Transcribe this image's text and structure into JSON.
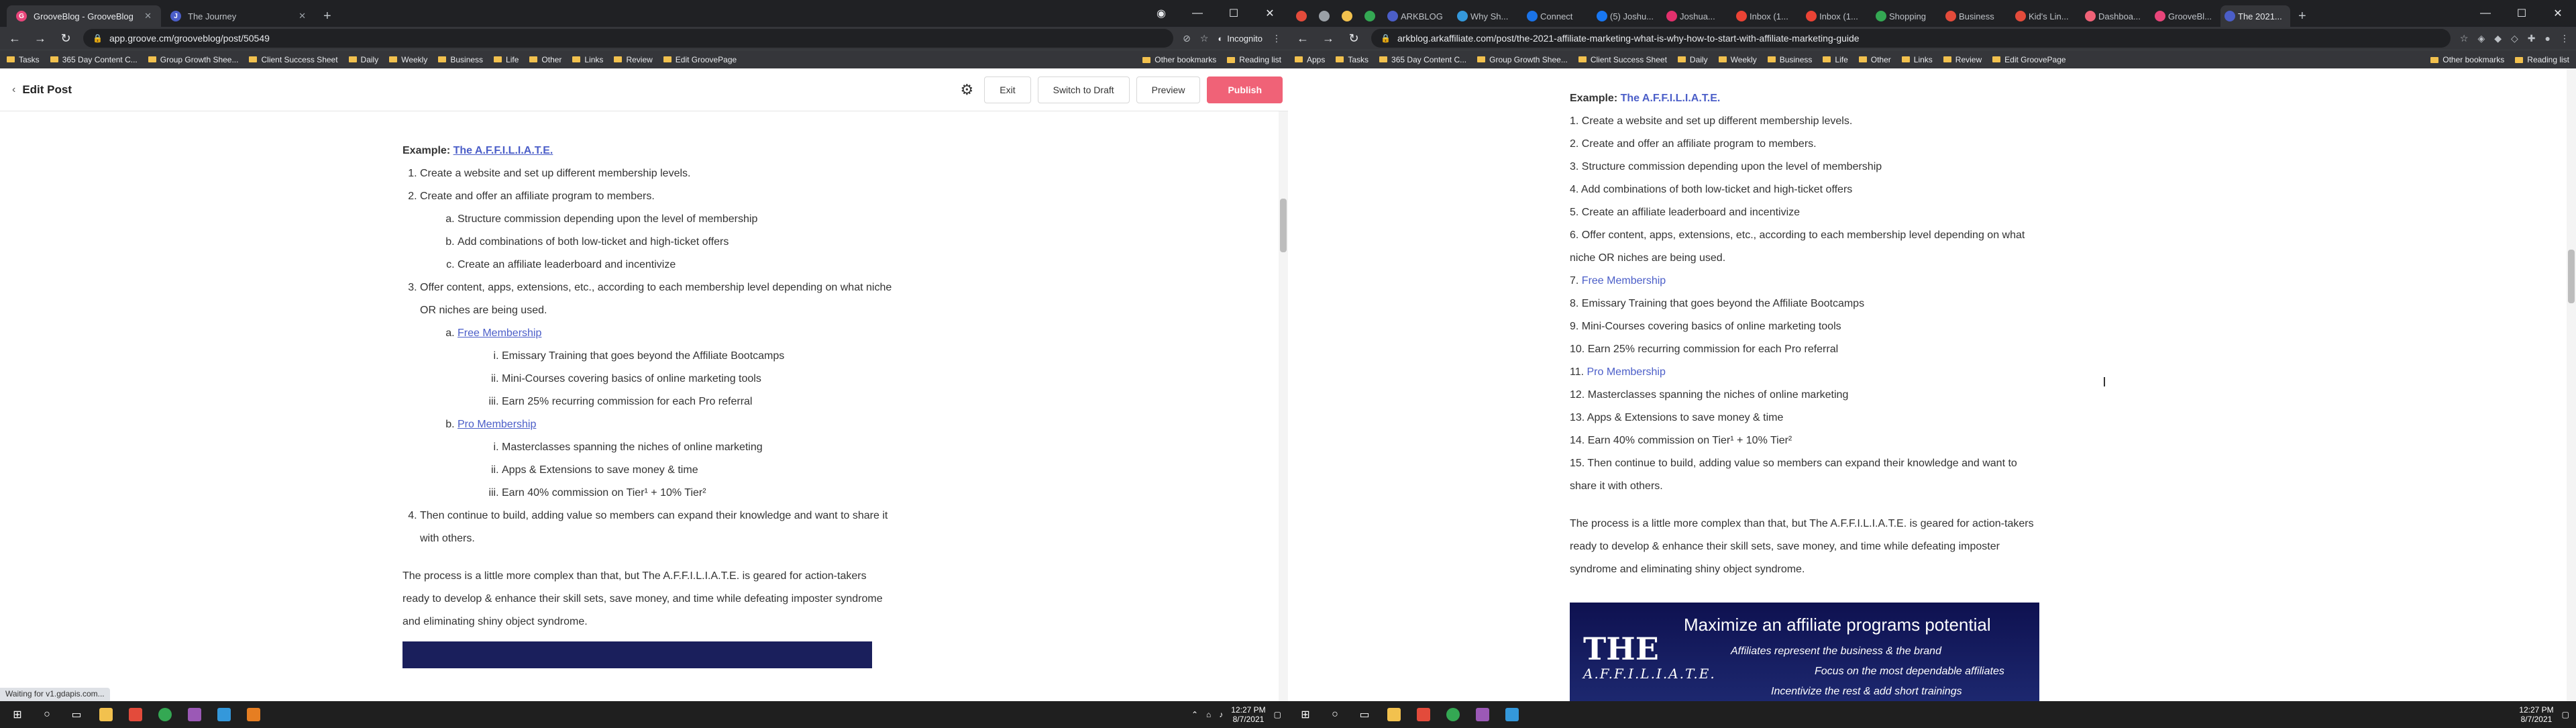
{
  "left": {
    "tabs": [
      {
        "title": "GrooveBlog - GrooveBlog",
        "color": "#e8457a",
        "active": true
      },
      {
        "title": "The Journey",
        "color": "#4b5ec8",
        "active": false
      }
    ],
    "url": "app.groove.cm/grooveblog/post/50549",
    "incognito_label": "Incognito",
    "bookmarks": [
      "Tasks",
      "365 Day Content C...",
      "Group Growth Shee...",
      "Client Success Sheet",
      "Daily",
      "Weekly",
      "Business",
      "Life",
      "Other",
      "Links",
      "Review",
      "Edit GroovePage"
    ],
    "bookmarks_right": [
      "Other bookmarks",
      "Reading list"
    ],
    "page_title": "Edit Post",
    "buttons": {
      "exit": "Exit",
      "draft": "Switch to Draft",
      "preview": "Preview",
      "publish": "Publish"
    },
    "status_text": "Waiting for v1.gdapis.com...",
    "clock_time": "12:27 PM",
    "clock_date": "8/7/2021"
  },
  "article": {
    "example_label": "Example:",
    "example_link": "The A.F.F.I.L.I.A.T.E.",
    "items": [
      {
        "text": "Create a website and set up different membership levels."
      },
      {
        "text": "Create and offer an affiliate program to members.",
        "sub": [
          "Structure commission depending upon the level of membership",
          "Add combinations of both low-ticket and high-ticket offers",
          "Create an affiliate leaderboard and incentivize"
        ]
      },
      {
        "text": "Offer content, apps, extensions, etc., according to each membership level depending on what niche OR niches are being used.",
        "sub_links": [
          {
            "label": "Free Membership",
            "sub": [
              "Emissary Training that goes beyond the Affiliate Bootcamps",
              "Mini-Courses covering basics of online marketing tools",
              "Earn 25% recurring commission for each Pro referral"
            ]
          },
          {
            "label": "Pro Membership",
            "sub": [
              "Masterclasses spanning the niches of online marketing",
              "Apps & Extensions to save money & time",
              "Earn 40% commission on Tier¹ + 10% Tier²"
            ]
          }
        ]
      },
      {
        "text": "Then continue to build, adding value so members can expand their knowledge and want to share it with others."
      }
    ],
    "paragraph": "The process is a little more complex than that, but The A.F.F.I.L.I.A.T.E. is geared for action-takers ready to develop & enhance their skill sets, save money, and time while defeating imposter syndrome and eliminating shiny object syndrome."
  },
  "right": {
    "tabs": [
      "",
      "",
      "",
      "",
      "ARKBLOG",
      "Why Sh...",
      "Connect",
      "(5) Joshu...",
      "Joshua...",
      "Inbox (1...",
      "Inbox (1...",
      "Shopping",
      "Business",
      "Kid's Lin...",
      "Dashboa...",
      "GrooveBl...",
      "The 2021..."
    ],
    "url": "arkblog.arkaffiliate.com/post/the-2021-affiliate-marketing-what-is-why-how-to-start-with-affiliate-marketing-guide",
    "bookmarks": [
      "Apps",
      "Tasks",
      "365 Day Content C...",
      "Group Growth Shee...",
      "Client Success Sheet",
      "Daily",
      "Weekly",
      "Business",
      "Life",
      "Other",
      "Links",
      "Review",
      "Edit GroovePage"
    ],
    "bookmarks_right": [
      "Other bookmarks",
      "Reading list"
    ],
    "list": [
      "1. Create a website and set up different membership levels.",
      "2. Create and offer an affiliate program to members.",
      "3. Structure commission depending upon the level of membership",
      "4. Add combinations of both low-ticket and high-ticket offers",
      "5. Create an affiliate leaderboard and incentivize",
      "6. Offer content, apps, extensions, etc., according to each membership level depending on what niche OR niches are being used.",
      "7. ",
      "8. Emissary Training that goes beyond the Affiliate Bootcamps",
      "9. Mini-Courses covering basics of online marketing tools",
      "10. Earn 25% recurring commission for each Pro referral",
      "11. ",
      "12. Masterclasses spanning the niches of online marketing",
      "13. Apps & Extensions to save money & time",
      "14. Earn 40% commission on Tier¹ + 10% Tier²",
      "15. Then continue to build, adding value so members can expand their knowledge and want to share it with others."
    ],
    "link7": "Free Membership",
    "link11": "Pro Membership",
    "paragraph": "The process is a little more complex than that, but The A.F.F.I.L.I.A.T.E. is geared for action-takers ready to develop & enhance their skill sets, save money, and time while defeating imposter syndrome and eliminating shiny object syndrome.",
    "banner": {
      "big": "THE",
      "small": "A.F.F.I.L.I.A.T.E.",
      "h1": "Maximize an affiliate programs potential",
      "h2": "Affiliates represent the business & the brand",
      "h3": "Focus on the most dependable affiliates",
      "h4": "Incentivize the rest & add short trainings"
    },
    "clock_time": "12:27 PM",
    "clock_date": "8/7/2021"
  }
}
